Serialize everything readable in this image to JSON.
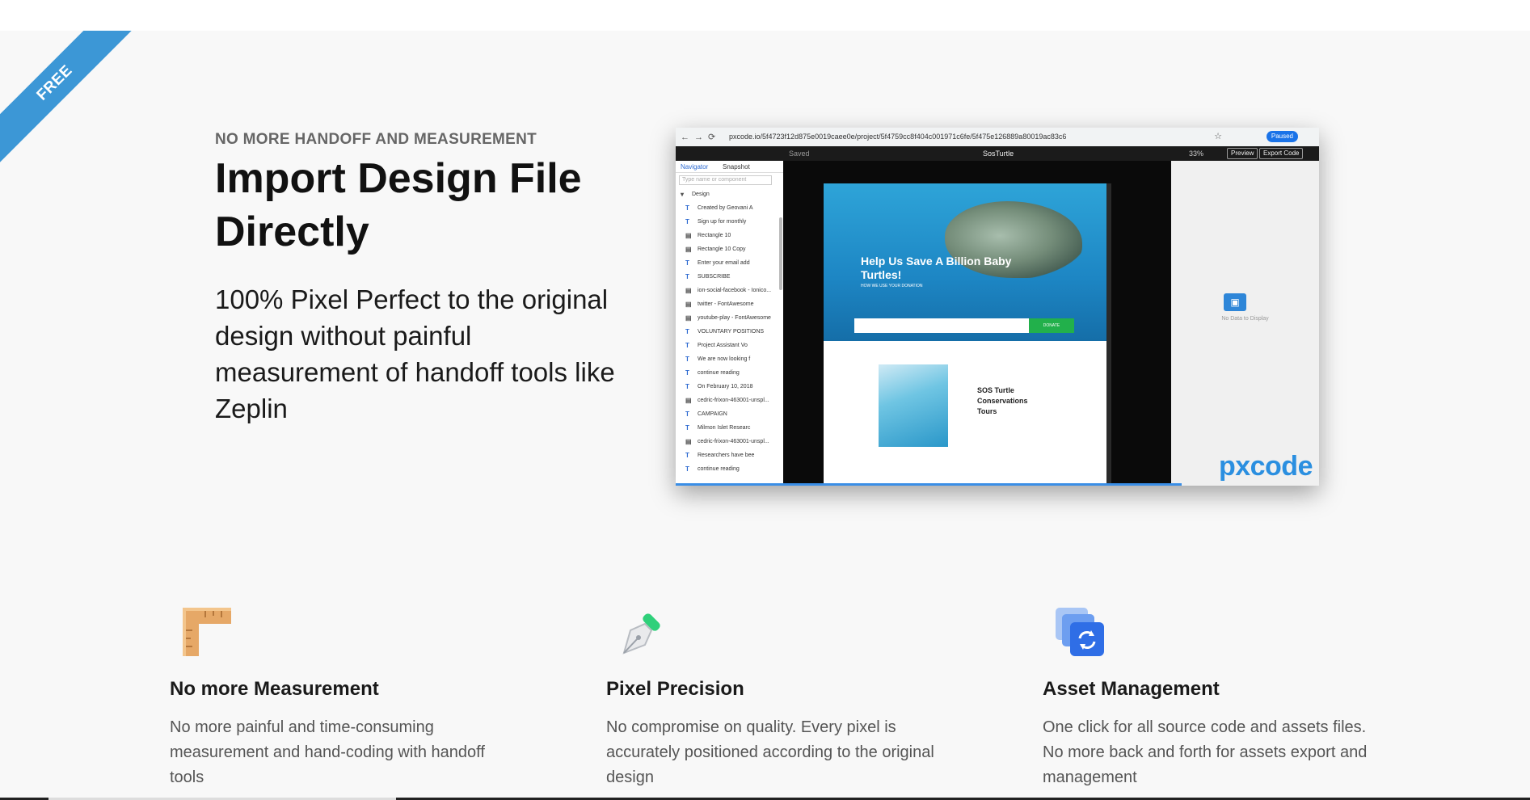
{
  "ribbon": {
    "label": "FREE"
  },
  "hero": {
    "eyebrow": "NO MORE HANDOFF AND MEASUREMENT",
    "title": "Import Design File Directly",
    "description": "100% Pixel Perfect to the original design without painful measurement of handoff tools like Zeplin"
  },
  "screenshot": {
    "url": "pxcode.io/5f4723f12d875e0019caee0e/project/5f4759cc8f404c001971c6fe/5f475e126889a80019ac83c6",
    "paused_label": "Paused",
    "saved_label": "Saved",
    "doc_name": "SosTurtle",
    "zoom": "33%",
    "preview_label": "Preview",
    "export_label": "Export Code",
    "tabs": [
      "Navigator",
      "Snapshot"
    ],
    "search_placeholder": "Type name or component",
    "layers": [
      "Design",
      "Created by Geovani A",
      "Sign up for monthly",
      "Rectangle 10",
      "Rectangle 10 Copy",
      "Enter your email add",
      "SUBSCRIBE",
      "ion-social-facebook - Ionico...",
      "twitter - FontAwesome",
      "youtube-play - FontAwesome",
      "VOLUNTARY POSITIONS",
      "Project Assistant Vo",
      "We are now looking f",
      "continue reading",
      "On February 10, 2018",
      "cedric-frixon-463001-unspl...",
      "CAMPAIGN",
      "Milmon Islet Researc",
      "cedric-frixon-463001-unspl...",
      "Researchers have bee",
      "continue reading"
    ],
    "hero_title": "Help Us Save A Billion Baby Turtles!",
    "hero_sub": "HOW WE USE YOUR DONATION",
    "donate_button": "DONATE",
    "sos_title": "SOS Turtle Conservations Tours",
    "no_data": "No Data to Display",
    "logo": "pxcode"
  },
  "features": [
    {
      "icon": "ruler-icon",
      "title": "No more Measurement",
      "text": "No more painful and time-consuming measurement and hand-coding with handoff tools"
    },
    {
      "icon": "pen-nib-icon",
      "title": "Pixel Precision",
      "text": "No compromise on quality. Every pixel is accurately positioned according to the original design"
    },
    {
      "icon": "asset-sync-icon",
      "title": "Asset Management",
      "text": "One click for all source code and assets files. No more back and forth for assets export and management"
    }
  ],
  "colors": {
    "accent": "#3c97d6",
    "logo": "#2b8fe0",
    "donate": "#22b04b"
  }
}
